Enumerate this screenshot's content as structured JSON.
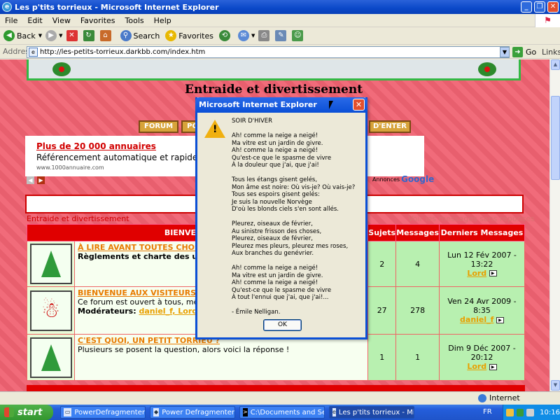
{
  "window": {
    "title": "Les p'tits torrieux - Microsoft Internet Explorer"
  },
  "menu": [
    "File",
    "Edit",
    "View",
    "Favorites",
    "Tools",
    "Help"
  ],
  "toolbar": {
    "back": "Back",
    "search": "Search",
    "favorites": "Favorites"
  },
  "address": {
    "label": "Address",
    "url": "http://les-petits-torrieux.darkbb.com/index.htm",
    "go": "Go",
    "links": "Links"
  },
  "site": {
    "title": "Entraide et divertissement",
    "nav": [
      "FORUM",
      "PO"
    ],
    "nav_right": "D'ENTER",
    "ad": {
      "title": "Plus de 20 000 annuaires",
      "text": "Référencement automatique et rapidement po",
      "url": "www.1000annuaire.com",
      "adsby": "Annonces",
      "google": "Google"
    },
    "breadcrumb": "Entraide et divertissement",
    "view_msgs": "Voir les messages sans réponses"
  },
  "forum": {
    "headers": {
      "title": "BIENVENUE À T",
      "topics": "Sujets",
      "messages": "Messages",
      "last": "Derniers Messages"
    },
    "rows": [
      {
        "title": "À LIRE AVANT TOUTES CHOSES",
        "desc": "Règlements et charte des utilisate",
        "mods_label": "",
        "mods": "",
        "topics": "2",
        "messages": "4",
        "last_date": "Lun 12 Fév 2007 - 13:22",
        "last_user": "Lord"
      },
      {
        "title": "BIENVENUE AUX VISITEURS !",
        "desc": "Ce forum est ouvert à tous, même",
        "mods_label": "Modérateurs:",
        "mods": "daniel_f, Lord, jaco",
        "topics": "27",
        "messages": "278",
        "last_date": "Ven 24 Avr 2009 - 8:35",
        "last_user": "daniel_f"
      },
      {
        "title": "C'EST QUOI, UN PETIT TORRIEU ?",
        "desc": "Plusieurs se posent la question, alors voici la réponse !",
        "mods_label": "",
        "mods": "",
        "topics": "1",
        "messages": "1",
        "last_date": "Dim 9 Déc 2007 - 20:12",
        "last_user": "Lord"
      }
    ]
  },
  "dialog": {
    "title": "Microsoft Internet Explorer",
    "text": "SOIR D'HIVER\n\nAh! comme la neige a neigé!\nMa vitre est un jardin de givre.\nAh! comme la neige a neigé!\nQu'est-ce que le spasme de vivre\nÀ la douleur que j'ai, que j'ai!\n\nTous les étangs gisent gelés,\nMon âme est noire: Où vis-je? Où vais-je?\nTous ses espoirs gisent gelés:\nJe suis la nouvelle Norvège\nD'où les blonds ciels s'en sont allés.\n\nPleurez, oiseaux de février,\nAu sinistre frisson des choses,\nPleurez, oiseaux de février,\nPleurez mes pleurs, pleurez mes roses,\nAux branches du genévrier.\n\nAh! comme la neige a neigé!\nMa vitre est un jardin de givre.\nAh! comme la neige a neigé!\nQu'est-ce que le spasme de vivre\nÀ tout l'ennui que j'ai, que j'ai!...\n\n- Émile Nelligan.",
    "ok": "OK"
  },
  "status": {
    "zone": "Internet"
  },
  "taskbar": {
    "start": "start",
    "tasks": [
      "PowerDefragmenter",
      "Power Defragmenter",
      "C:\\Documents and Se...",
      "Les p'tits torrieux - Mi..."
    ],
    "lang": "FR",
    "clock": "10:16"
  }
}
